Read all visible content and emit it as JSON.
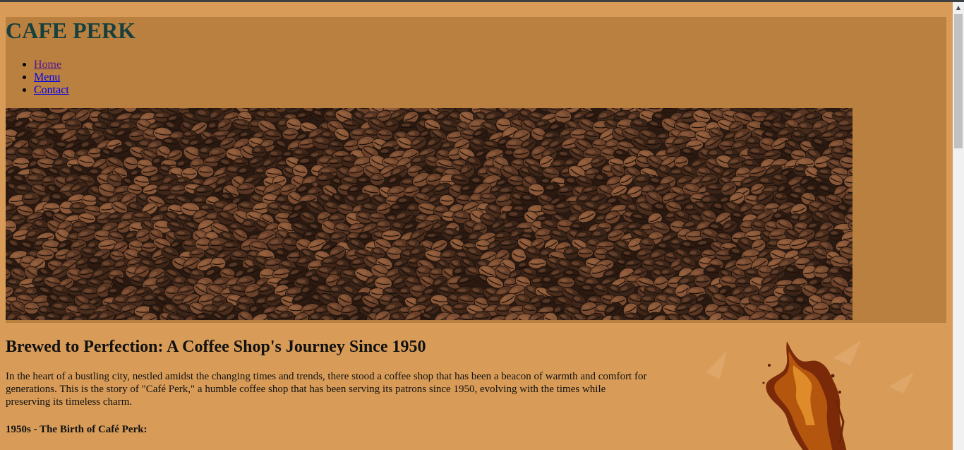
{
  "site": {
    "title": "CAFE PERK"
  },
  "nav": {
    "items": [
      {
        "label": "Home"
      },
      {
        "label": "Menu"
      },
      {
        "label": "Contact"
      }
    ]
  },
  "hero": {
    "icon": "coffee-beans-image"
  },
  "article": {
    "title": "Brewed to Perfection: A Coffee Shop's Journey Since 1950",
    "intro": "In the heart of a bustling city, nestled amidst the changing times and trends, there stood a coffee shop that has been a beacon of warmth and comfort for generations. This is the story of \"Café Perk,\" a humble coffee shop that has been serving its patrons since 1950, evolving with the times while preserving its timeless charm.",
    "section_heading": "1950s - The Birth of Café Perk:"
  },
  "colors": {
    "page_background": "#d89c58",
    "header_background": "#b9803f",
    "title_color": "#163f3d",
    "link_visited": "#551a8b",
    "link_unvisited": "#0000ee"
  }
}
